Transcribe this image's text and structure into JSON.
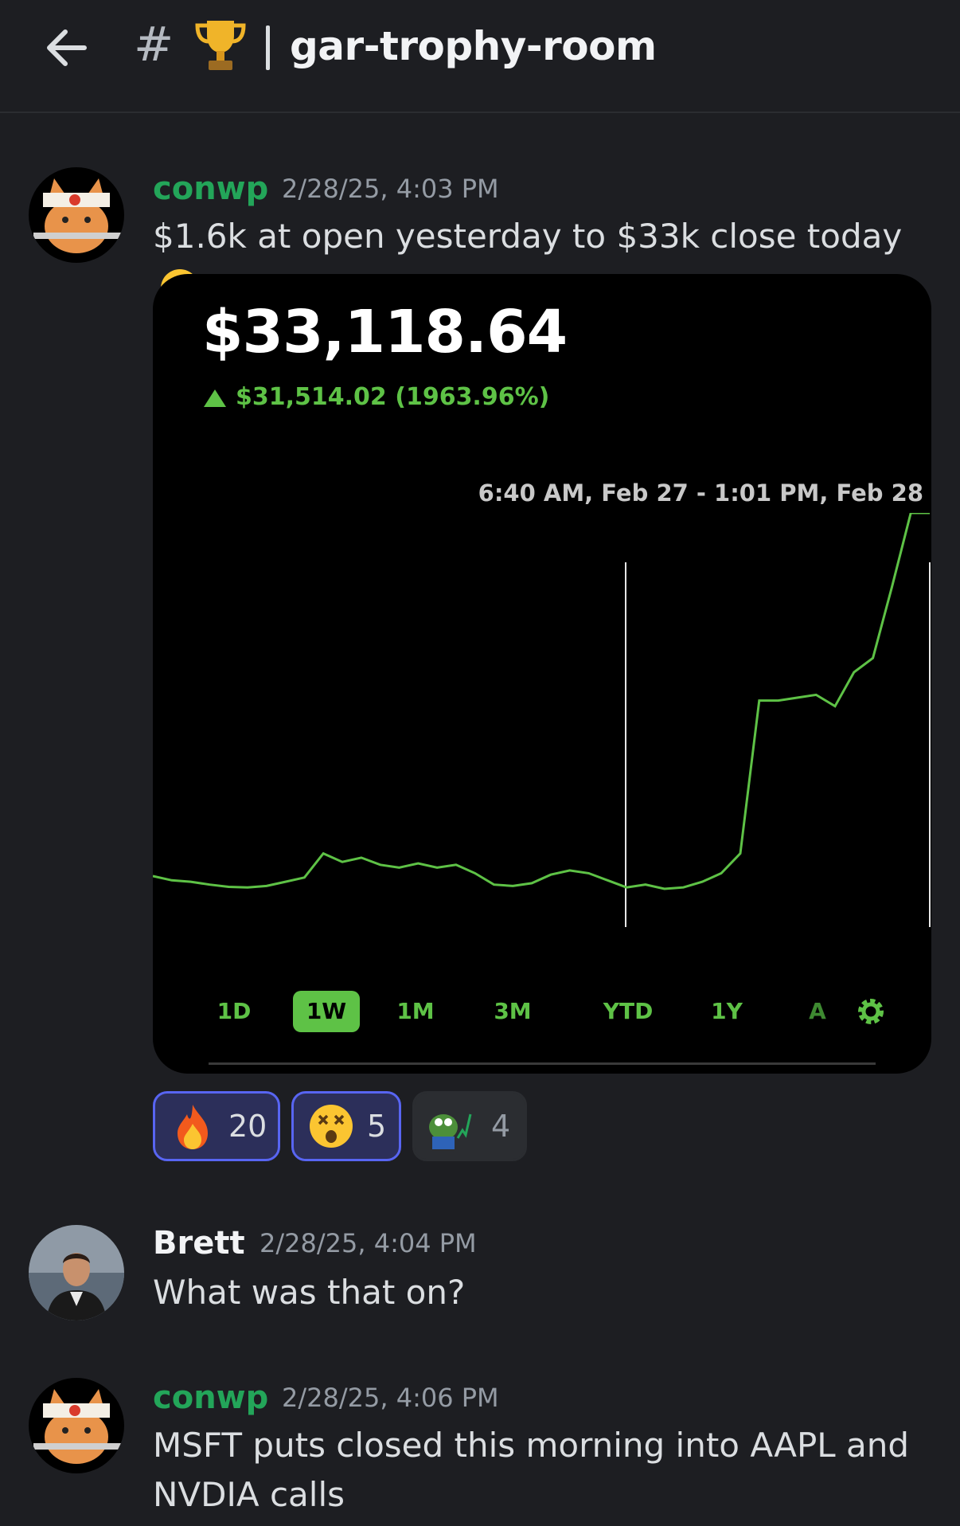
{
  "header": {
    "channel_emoji_icon": "trophy-icon",
    "channel_name": "gar-trophy-room"
  },
  "messages": [
    {
      "author": "conwp",
      "author_color": "#23a559",
      "time": "2/28/25, 4:03 PM",
      "text": "$1.6k at open yesterday to $33k close today"
    },
    {
      "author": "Brett",
      "author_color": "#f2f3f5",
      "time": "2/28/25, 4:04 PM",
      "text": "What was that on?"
    },
    {
      "author": "conwp",
      "author_color": "#23a559",
      "time": "2/28/25, 4:06 PM",
      "text": "MSFT puts closed this morning into AAPL and NVDIA calls"
    }
  ],
  "screenshot": {
    "balance": "$33,118.64",
    "change": "$31,514.02 (1963.96%)",
    "range_label": "6:40 AM, Feb 27 - 1:01 PM, Feb 28",
    "periods": [
      "1D",
      "1W",
      "1M",
      "3M",
      "YTD",
      "1Y",
      "A"
    ],
    "active_period": "1W"
  },
  "reactions": [
    {
      "emoji": "fire-icon",
      "count": "20",
      "mine": true
    },
    {
      "emoji": "dizzy-face-icon",
      "count": "5",
      "mine": true
    },
    {
      "emoji": "pepe-stonks-icon",
      "count": "4",
      "mine": false
    }
  ],
  "chart_data": {
    "type": "line",
    "title": "",
    "xlabel": "",
    "ylabel": "",
    "grid": false,
    "series": [
      {
        "color": "#5ec246",
        "values": [
          1800,
          1650,
          1600,
          1500,
          1420,
          1400,
          1450,
          1600,
          1750,
          2600,
          2300,
          2450,
          2200,
          2100,
          2250,
          2100,
          2200,
          1900,
          1500,
          1450,
          1550,
          1850,
          2000,
          1900,
          1650,
          1400,
          1500,
          1350,
          1400,
          1600,
          1900,
          2600,
          8000,
          8000,
          8100,
          8200,
          7800,
          9000,
          9500,
          12000,
          15500,
          17000
        ]
      }
    ]
  }
}
